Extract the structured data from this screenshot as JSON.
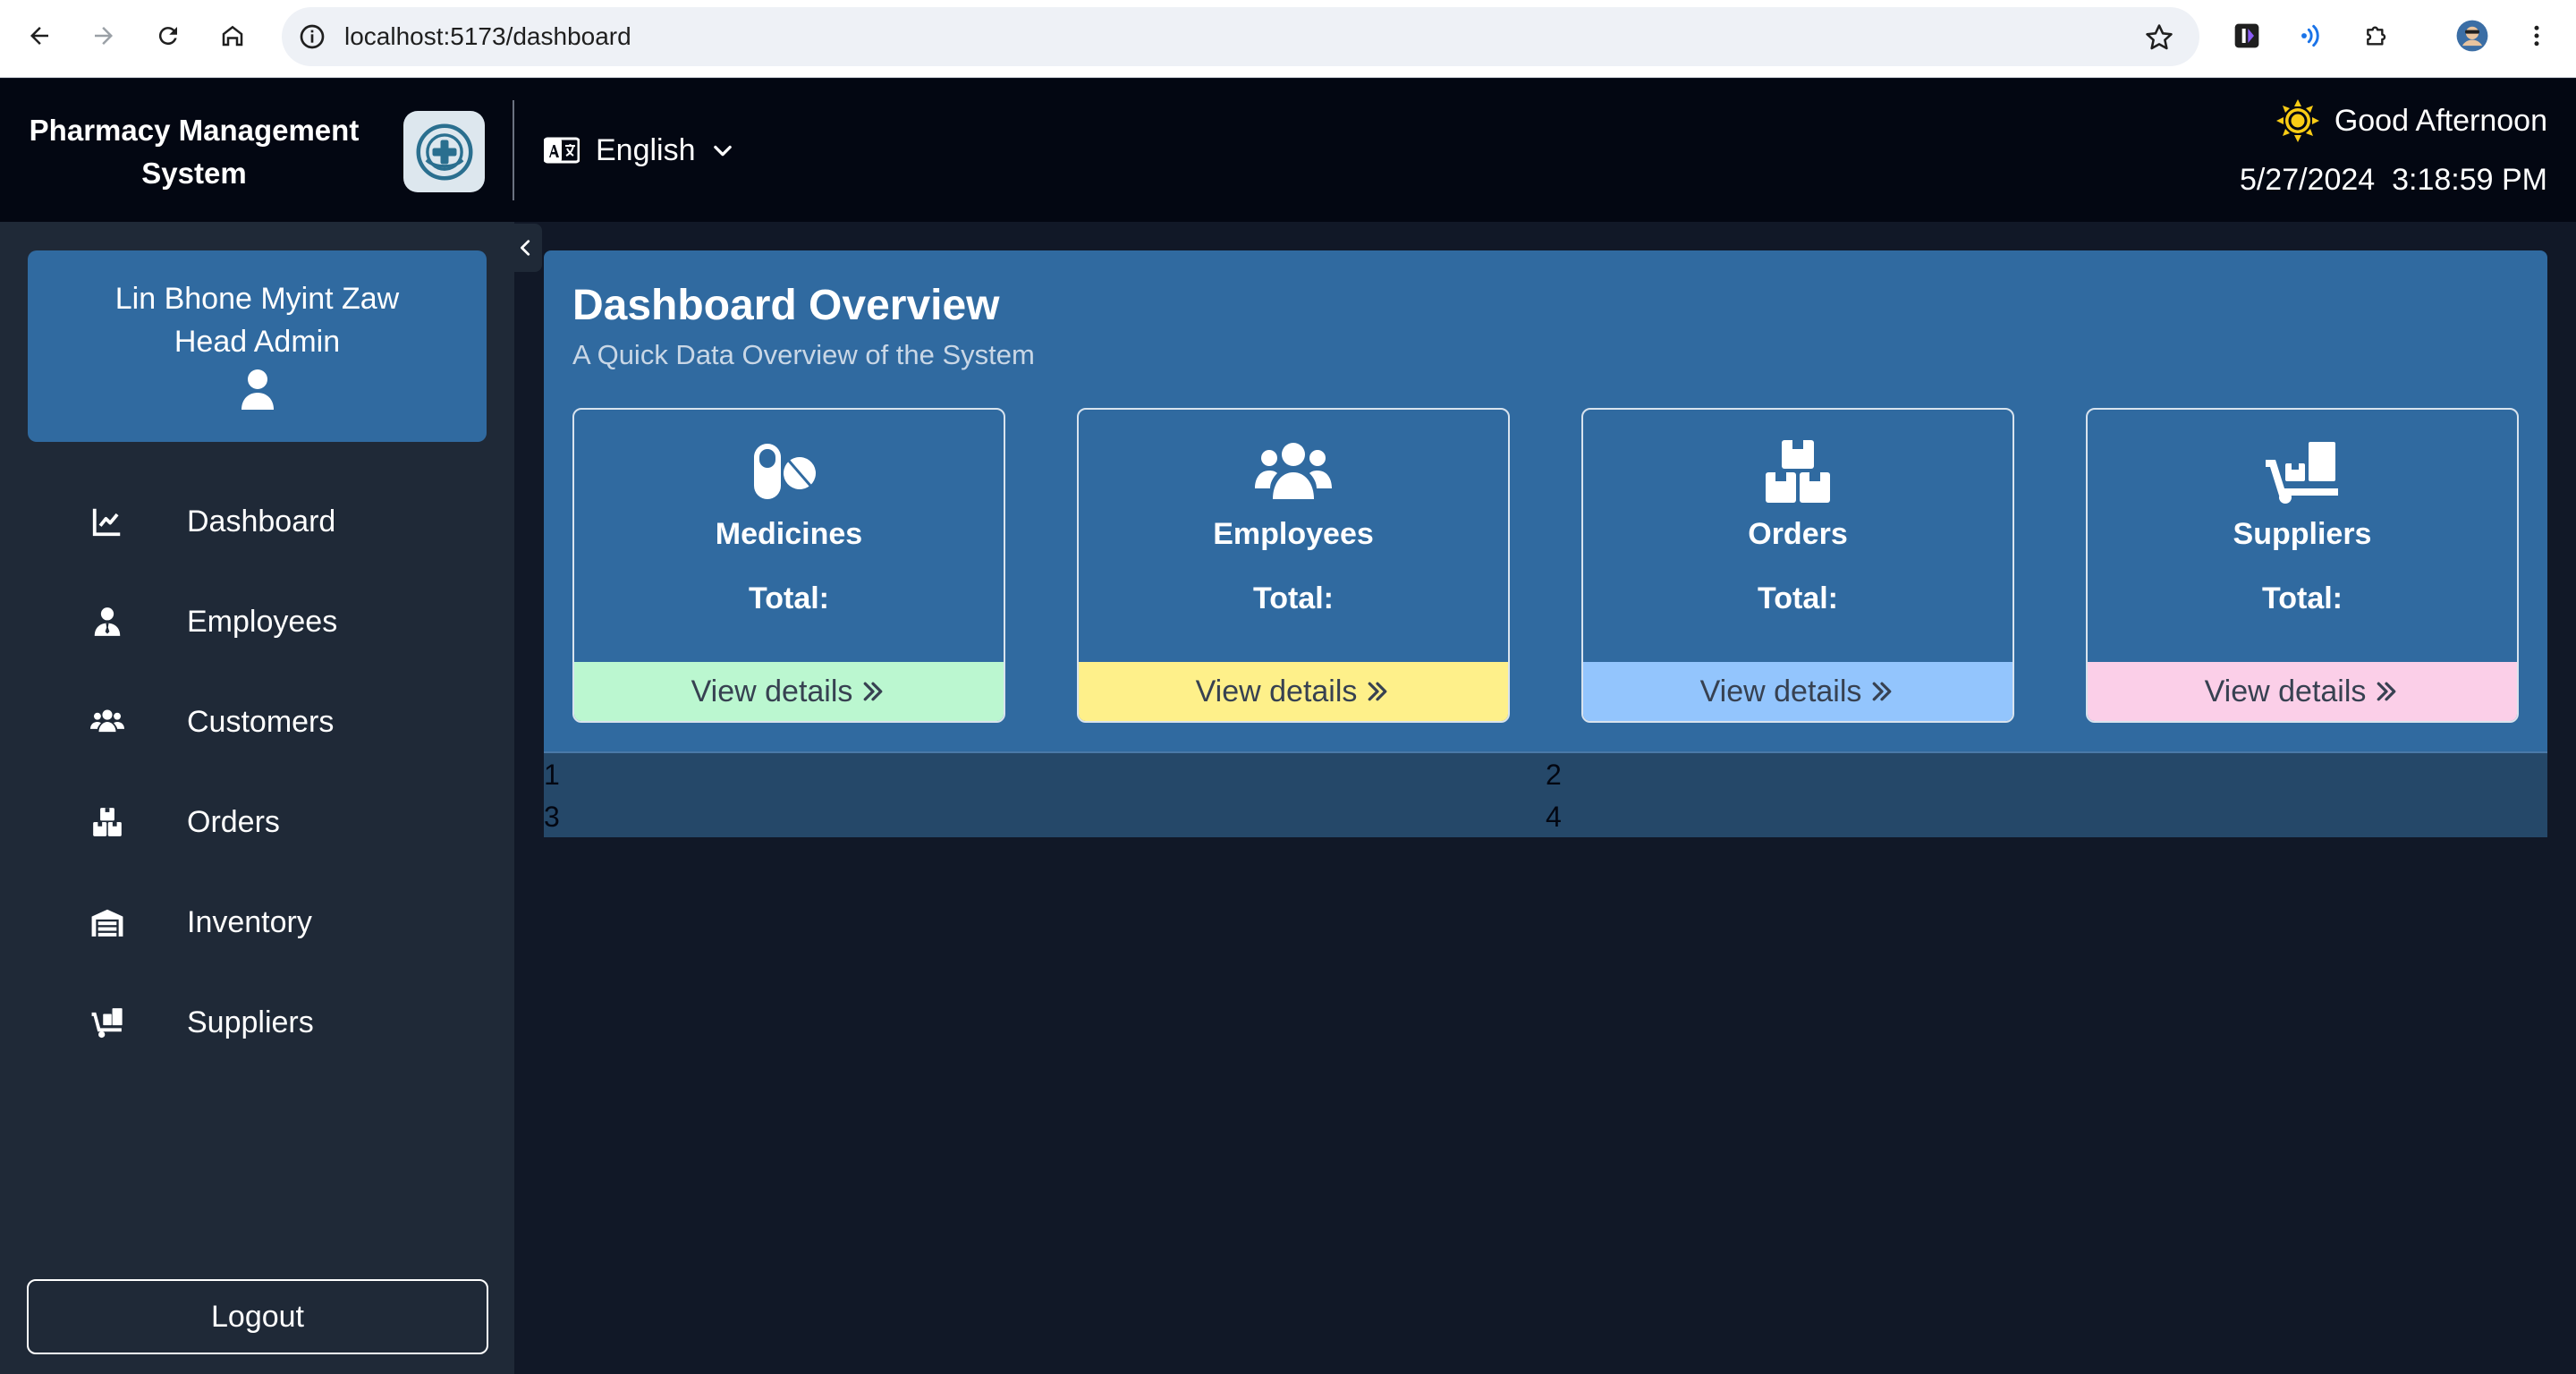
{
  "browser": {
    "url": "localhost:5173/dashboard"
  },
  "header": {
    "brand_line1": "Pharmacy Management",
    "brand_line2": "System",
    "language": "English",
    "greeting": "Good Afternoon",
    "date": "5/27/2024",
    "time": "3:18:59 PM"
  },
  "profile": {
    "name": "Lin Bhone Myint Zaw",
    "role": "Head Admin"
  },
  "sidebar": {
    "items": [
      {
        "label": "Dashboard",
        "icon": "chart-line-icon"
      },
      {
        "label": "Employees",
        "icon": "user-tie-icon"
      },
      {
        "label": "Customers",
        "icon": "users-icon"
      },
      {
        "label": "Orders",
        "icon": "boxes-icon"
      },
      {
        "label": "Inventory",
        "icon": "warehouse-icon"
      },
      {
        "label": "Suppliers",
        "icon": "dolly-icon"
      }
    ],
    "logout_label": "Logout"
  },
  "overview": {
    "title": "Dashboard Overview",
    "subtitle": "A Quick Data Overview of the System",
    "cards": [
      {
        "title": "Medicines",
        "total_label": "Total:",
        "link": "View details",
        "icon": "pills-icon",
        "footer_color": "#bbf7d0"
      },
      {
        "title": "Employees",
        "total_label": "Total:",
        "link": "View details",
        "icon": "users-icon",
        "footer_color": "#fef08a"
      },
      {
        "title": "Orders",
        "total_label": "Total:",
        "link": "View details",
        "icon": "boxes-icon",
        "footer_color": "#93c5fd"
      },
      {
        "title": "Suppliers",
        "total_label": "Total:",
        "link": "View details",
        "icon": "dolly-icon",
        "footer_color": "#fbcfe8"
      }
    ]
  },
  "grid_cells": [
    "1",
    "2",
    "3",
    "4"
  ]
}
